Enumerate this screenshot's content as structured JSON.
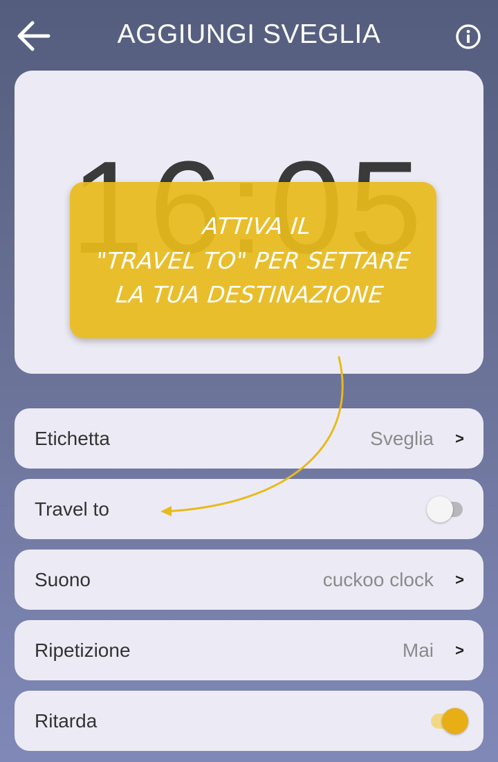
{
  "header": {
    "title": "AGGIUNGI SVEGLIA",
    "back_icon": "arrow-left-icon",
    "info_icon": "info-icon"
  },
  "time": {
    "display": "16:05"
  },
  "tutorial": {
    "lines": [
      "ATTIVA IL",
      "\"TRAVEL TO\" PER SETTARE",
      "LA TUA DESTINAZIONE"
    ]
  },
  "settings": {
    "label_row": {
      "label": "Etichetta",
      "value": "Sveglia",
      "chevron": ">"
    },
    "travel_row": {
      "label": "Travel to",
      "toggle_on": false
    },
    "sound_row": {
      "label": "Suono",
      "value": "cuckoo clock",
      "chevron": ">"
    },
    "repeat_row": {
      "label": "Ripetizione",
      "value": "Mai",
      "chevron": ">"
    },
    "snooze_row": {
      "label": "Ritarda",
      "toggle_on": true
    }
  },
  "colors": {
    "accent": "#e8ae16",
    "callout": "#e8ba1c",
    "card": "#ecebf5"
  }
}
